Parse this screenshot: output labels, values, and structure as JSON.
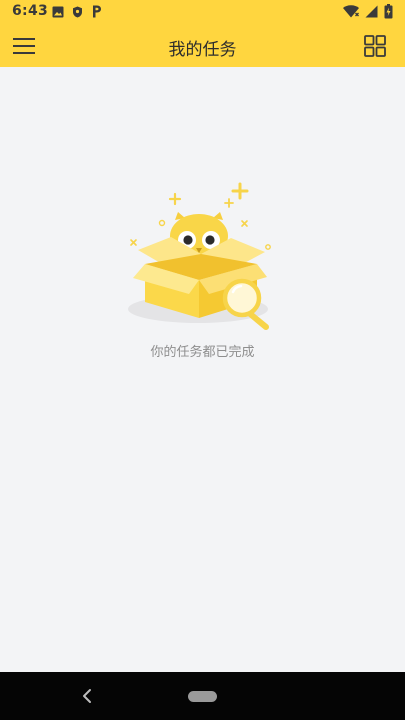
{
  "status_bar": {
    "time": "6:43",
    "left_icons": [
      "image-icon",
      "shield-icon",
      "parking-icon"
    ],
    "right_icons": [
      "wifi-icon",
      "signal-icon",
      "battery-icon"
    ]
  },
  "header": {
    "title": "我的任务",
    "menu_icon": "hamburger-menu-icon",
    "view_icon": "grid-view-icon",
    "background": "#ffd63f"
  },
  "empty_state": {
    "illustration": "owl-in-box-search-illustration",
    "message": "你的任务都已完成"
  },
  "nav_bar": {
    "back_icon": "back-chevron-icon",
    "home_icon": "home-pill-icon"
  }
}
